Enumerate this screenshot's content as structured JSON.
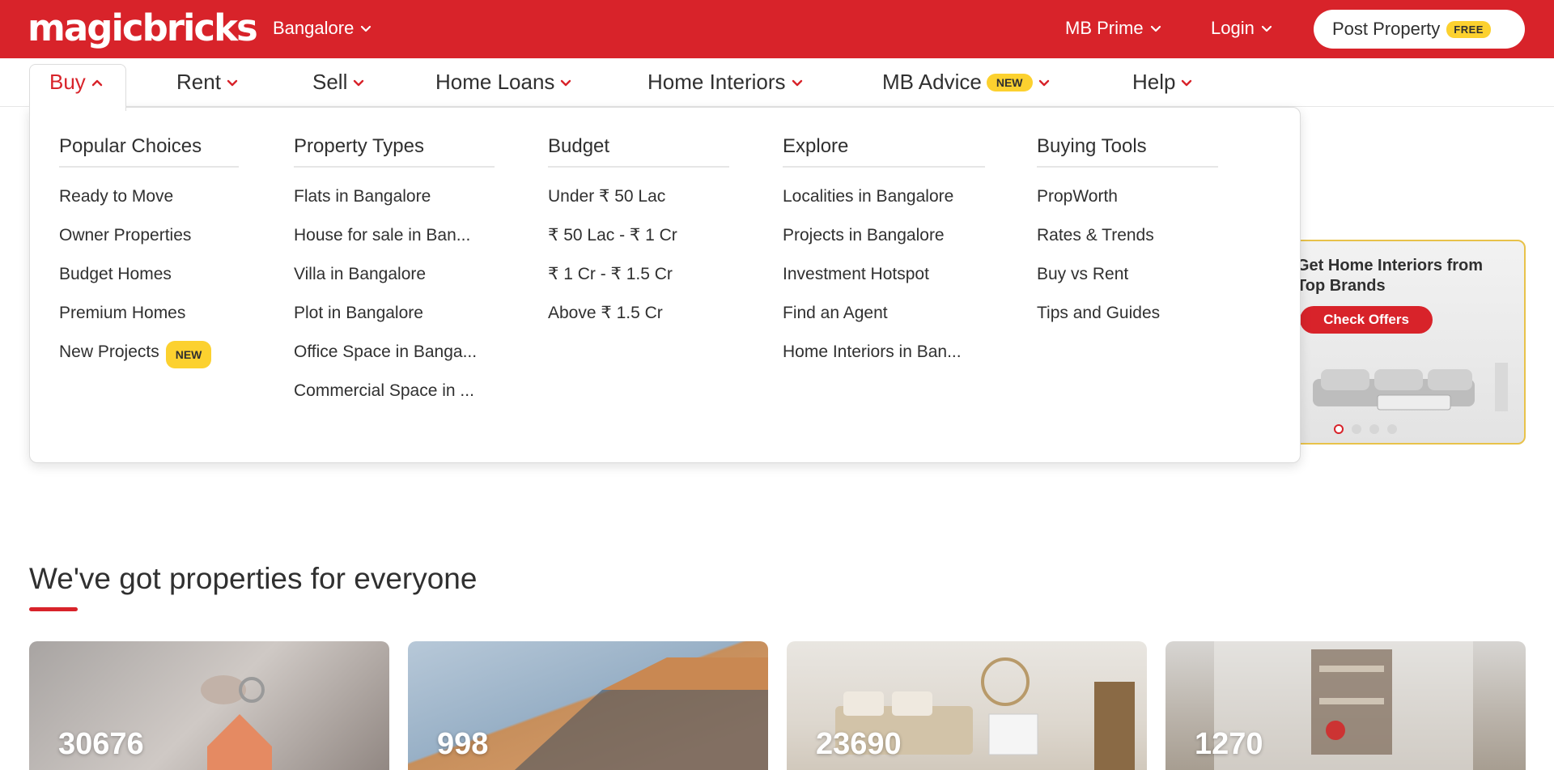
{
  "header": {
    "logo": "magicbricks",
    "city": "Bangalore",
    "links": [
      "MB Prime",
      "Login"
    ],
    "post_property": "Post Property",
    "free_badge": "FREE"
  },
  "nav": {
    "items": [
      {
        "label": "Buy",
        "active": true
      },
      {
        "label": "Rent"
      },
      {
        "label": "Sell"
      },
      {
        "label": "Home Loans"
      },
      {
        "label": "Home Interiors"
      },
      {
        "label": "MB Advice",
        "badge": "NEW"
      },
      {
        "label": "Help"
      }
    ]
  },
  "dropdown": {
    "columns": [
      {
        "heading": "Popular Choices",
        "items": [
          "Ready to Move",
          "Owner Properties",
          "Budget Homes",
          "Premium Homes",
          "New Projects"
        ],
        "badge": "NEW"
      },
      {
        "heading": "Property Types",
        "items": [
          "Flats in Bangalore",
          "House for sale in Ban...",
          "Villa in Bangalore",
          "Plot in Bangalore",
          "Office Space in Banga...",
          "Commercial Space in ..."
        ]
      },
      {
        "heading": "Budget",
        "items": [
          "Under ₹ 50 Lac",
          "₹ 50 Lac - ₹ 1 Cr",
          "₹ 1 Cr - ₹ 1.5 Cr",
          "Above ₹ 1.5 Cr"
        ]
      },
      {
        "heading": "Explore",
        "items": [
          "Localities in Bangalore",
          "Projects in Bangalore",
          "Investment Hotspot",
          "Find an Agent",
          "Home Interiors in Ban..."
        ]
      },
      {
        "heading": "Buying Tools",
        "items": [
          "PropWorth",
          "Rates & Trends",
          "Buy vs Rent",
          "Tips and Guides"
        ]
      }
    ]
  },
  "ad": {
    "title_line1": "Get Home Interiors from",
    "title_line2": "Top Brands",
    "button": "Check Offers",
    "slides": 4,
    "active_slide": 1
  },
  "section": {
    "title": "We've got properties for everyone"
  },
  "cards": [
    {
      "count": "30676"
    },
    {
      "count": "998"
    },
    {
      "count": "23690"
    },
    {
      "count": "1270"
    }
  ],
  "colors": {
    "brand_red": "#d8232a",
    "badge_yellow": "#fcd12f",
    "text": "#303030"
  }
}
